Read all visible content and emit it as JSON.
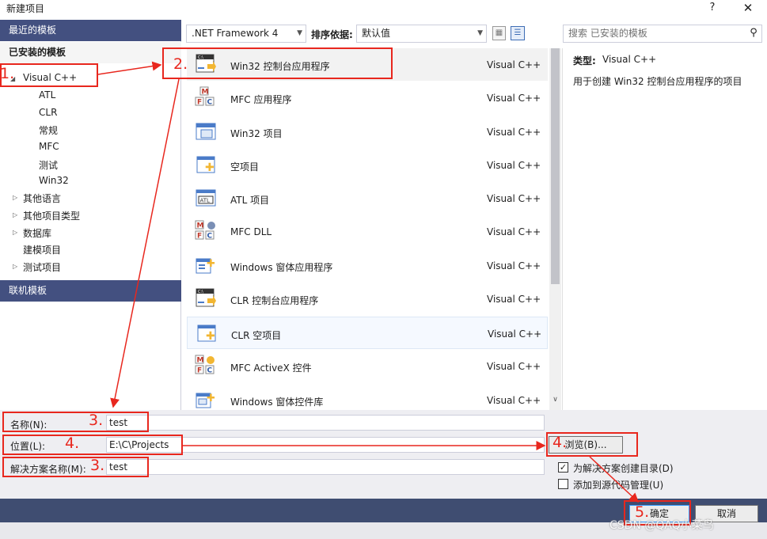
{
  "window": {
    "title": "新建项目",
    "help_glyph": "?",
    "close_glyph": "✕"
  },
  "left_panel": {
    "recent_header": "最近的模板",
    "installed_header": "已安装的模板",
    "online_header": "联机模板",
    "tree": {
      "visual_cpp": "Visual C++",
      "children": [
        "ATL",
        "CLR",
        "常规",
        "MFC",
        "测试",
        "Win32"
      ],
      "other_items": [
        "其他语言",
        "其他项目类型",
        "数据库"
      ],
      "modeling_project": "建模项目",
      "test_project": "测试项目"
    }
  },
  "toolbar": {
    "framework": ".NET Framework 4",
    "sort_label": "排序依据:",
    "sort_value": "默认值",
    "search_placeholder": "搜索 已安装的模板"
  },
  "templates": [
    {
      "name": "Win32 控制台应用程序",
      "lang": "Visual C++",
      "icon": "console-app-icon"
    },
    {
      "name": "MFC 应用程序",
      "lang": "Visual C++",
      "icon": "mfc-app-icon"
    },
    {
      "name": "Win32 项目",
      "lang": "Visual C++",
      "icon": "win32-project-icon"
    },
    {
      "name": "空项目",
      "lang": "Visual C++",
      "icon": "empty-project-icon"
    },
    {
      "name": "ATL 项目",
      "lang": "Visual C++",
      "icon": "atl-project-icon"
    },
    {
      "name": "MFC DLL",
      "lang": "Visual C++",
      "icon": "mfc-dll-icon"
    },
    {
      "name": "Windows 窗体应用程序",
      "lang": "Visual C++",
      "icon": "windows-forms-app-icon"
    },
    {
      "name": "CLR 控制台应用程序",
      "lang": "Visual C++",
      "icon": "clr-console-app-icon"
    },
    {
      "name": "CLR 空项目",
      "lang": "Visual C++",
      "icon": "clr-empty-project-icon"
    },
    {
      "name": "MFC ActiveX 控件",
      "lang": "Visual C++",
      "icon": "mfc-activex-icon"
    },
    {
      "name": "Windows 窗体控件库",
      "lang": "Visual C++",
      "icon": "windows-forms-control-icon"
    }
  ],
  "description": {
    "type_label": "类型:",
    "type_value": "Visual C++",
    "text": "用于创建 Win32 控制台应用程序的项目"
  },
  "form": {
    "name_label": "名称(N):",
    "name_value": "test",
    "location_label": "位置(L):",
    "location_value": "E:\\C\\Projects",
    "solution_label": "解决方案名称(M):",
    "solution_value": "test",
    "browse_label": "浏览(B)...",
    "create_dir_label": "为解决方案创建目录(D)",
    "create_dir_checked": true,
    "source_control_label": "添加到源代码管理(U)",
    "source_control_checked": false
  },
  "footer": {
    "ok_label": "确定",
    "cancel_label": "取消"
  },
  "annotations": {
    "n1": "1.",
    "n2": "2.",
    "n3a": "3.",
    "n4a": "4.",
    "n3b": "3.",
    "n4b": "4.",
    "n5": "5."
  },
  "watermark": "CSDN @QAQ小菜鸟",
  "colors": {
    "accent": "#435080",
    "annotation": "#e8271e",
    "selected_row": "#f2f2f2"
  }
}
